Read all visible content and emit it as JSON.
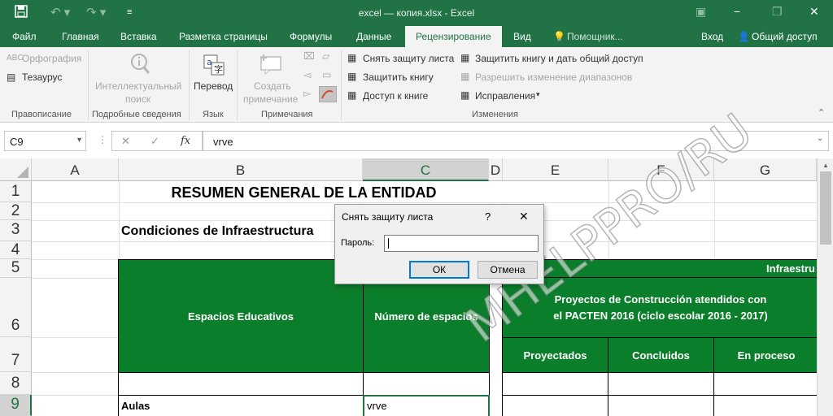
{
  "window": {
    "title": "excel — копия.xlsx - Excel",
    "controls": [
      "▣",
      "−",
      "❐",
      "✕"
    ]
  },
  "quick_access": {
    "save_icon": "save-icon",
    "undo_icon": "undo-icon",
    "redo_icon": "redo-icon",
    "customize_icon": "customize-icon"
  },
  "tabs": [
    {
      "label": "Файл"
    },
    {
      "label": "Главная"
    },
    {
      "label": "Вставка"
    },
    {
      "label": "Разметка страницы"
    },
    {
      "label": "Формулы"
    },
    {
      "label": "Данные"
    },
    {
      "label": "Рецензирование",
      "active": true
    },
    {
      "label": "Вид"
    },
    {
      "label": "Помощник..."
    }
  ],
  "account": {
    "signin": "Вход",
    "share": "Общий доступ"
  },
  "ribbon": {
    "spelling": "Орфография",
    "thesaurus": "Тезаурус",
    "smart_lookup": [
      "Интеллектуальный",
      "поиск"
    ],
    "translate": "Перевод",
    "new_comment": [
      "Создать",
      "примечание"
    ],
    "unprotect_sheet": "Снять защиту листа",
    "protect_workbook": "Защитить книгу",
    "share_workbook": "Доступ к книге",
    "protect_share": "Защитить книгу и дать общий доступ",
    "allow_edit_ranges": "Разрешить изменение диапазонов",
    "track_changes": "Исправления",
    "groups": {
      "proofing": "Правописание",
      "insights": "Подробные сведения",
      "language": "Язык",
      "comments": "Примечания",
      "changes": "Изменения"
    }
  },
  "formula_bar": {
    "name_box": "C9",
    "cancel": "✕",
    "enter": "✓",
    "fx": "fx",
    "value": "vrve"
  },
  "sheet": {
    "columns": [
      "A",
      "B",
      "C",
      "D",
      "E",
      "F",
      "G"
    ],
    "rows": [
      "1",
      "2",
      "3",
      "4",
      "5",
      "6",
      "7",
      "8",
      "9"
    ],
    "title": "RESUMEN GENERAL DE LA ENTIDAD",
    "subtitle": "Condiciones de Infraestructura",
    "hdr_espacios": "Espacios Educativos",
    "hdr_numero": "Número de espacios",
    "hdr_infra": "Infraestru",
    "hdr_proyectos": "Proyectos de Construcción atendidos con el PACTEN 2016 (ciclo escolar 2016 - 2017)",
    "hdr_proyectados": "Proyectados",
    "hdr_concluidos": "Concluidos",
    "hdr_enproceso": "En proceso",
    "row9_b": "Aulas",
    "row9_c": "vrve"
  },
  "dialog": {
    "title": "Снять защиту листа",
    "help": "?",
    "close": "✕",
    "password_label": "Пароль:",
    "password_value": "",
    "ok": "ОК",
    "cancel": "Отмена"
  },
  "watermark": "MHELPPRO/RU"
}
